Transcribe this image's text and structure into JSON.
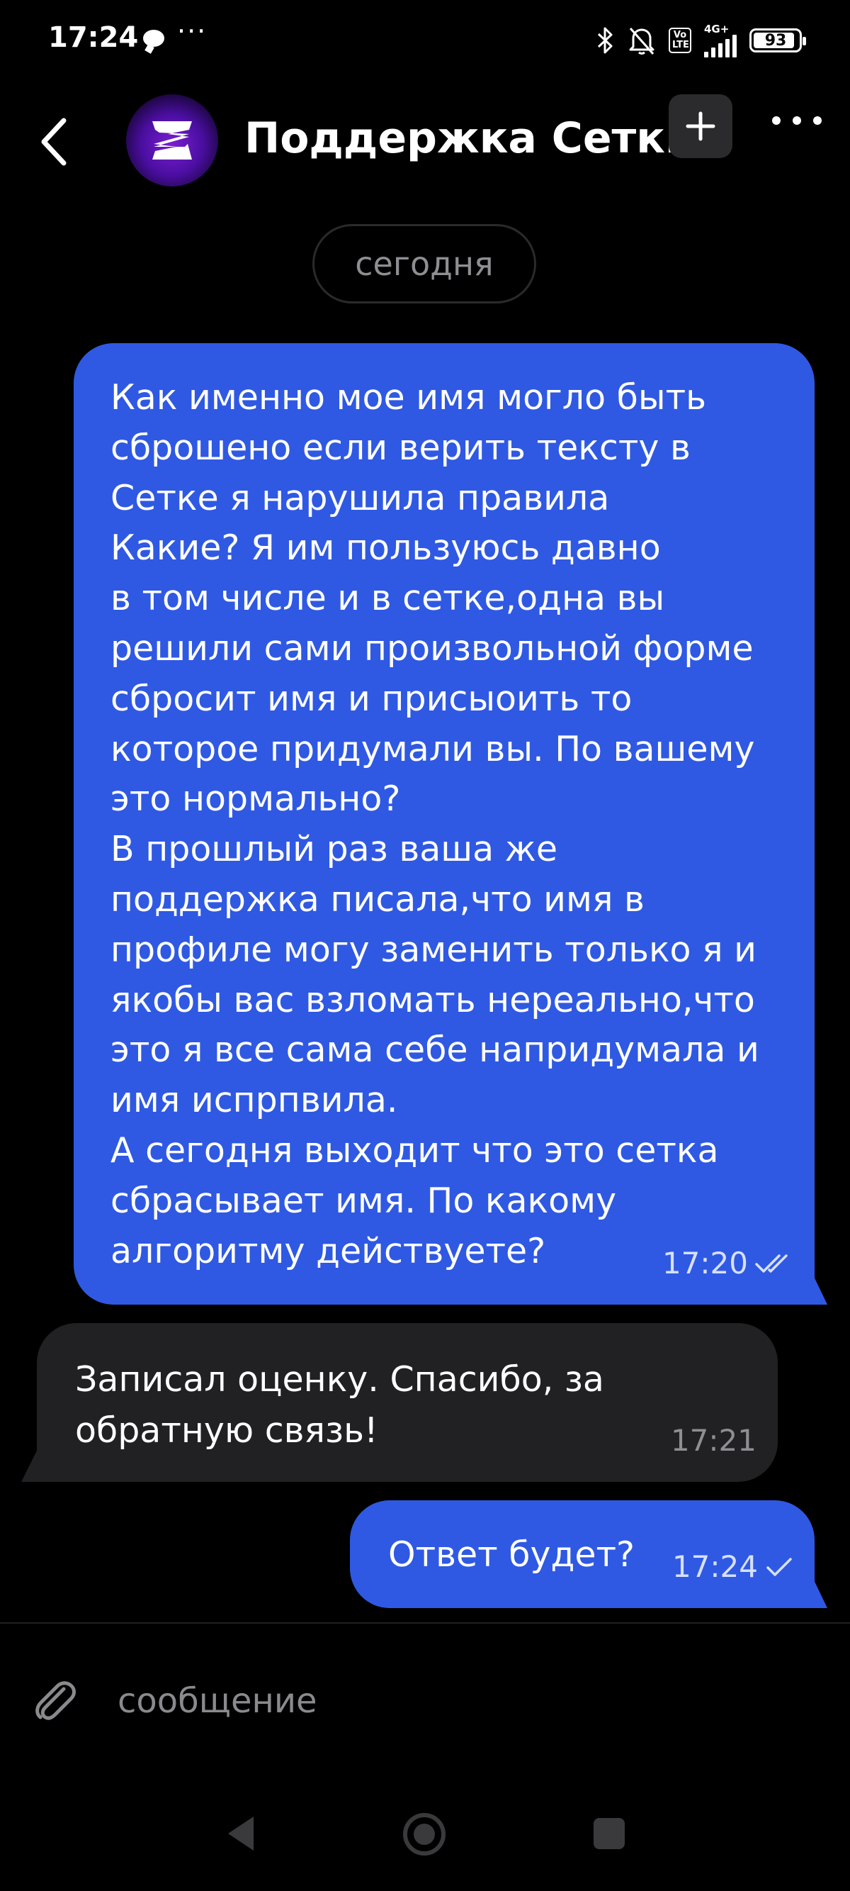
{
  "status_bar": {
    "time": "17:24",
    "more_indicator": "···",
    "network": "4G+",
    "volte": "Vo LTE",
    "battery_percent": 93,
    "battery_label": "93",
    "icons": [
      "chat-notification-icon",
      "bluetooth-icon",
      "bell-off-icon",
      "volte-icon",
      "signal-icon",
      "battery-icon"
    ]
  },
  "header": {
    "title": "Поддержка Сетки",
    "back_icon": "chevron-left-icon",
    "add_icon": "plus-icon",
    "more_icon": "more-horizontal-icon",
    "avatar_icon": "setka-logo-icon"
  },
  "date_divider": "сегодня",
  "messages": [
    {
      "direction": "outgoing",
      "text": "Как именно мое имя могло быть\nсброшено если верить тексту в\nСетке я нарушила правила\nКакие?  Я им пользуюсь давно\nв том числе и в сетке,одна вы\nрешили сами произвольной форме\nсбросит имя и присыоить то\nкоторое придумали вы. По вашему\nэто нормально?\nВ прошлый раз ваша же\nподдержка писала,что имя в\nпрофиле могу заменить только я и\nякобы вас взломать нереально,что\nэто я все сама себе напридумала и\nимя испрпвила.\nА сегодня выходит что это сетка\nсбрасывает имя. По какому\nалгоритму действуете?",
      "time": "17:20",
      "status_icon": "double-check-icon"
    },
    {
      "direction": "incoming",
      "text": "Записал оценку. Спасибо, за\nобратную связь!",
      "time": "17:21"
    },
    {
      "direction": "outgoing",
      "text": "Ответ будет?",
      "time": "17:24",
      "status_icon": "check-icon"
    }
  ],
  "composer": {
    "placeholder": "сообщение",
    "value": "",
    "attach_icon": "paperclip-icon"
  },
  "nav_bar": {
    "icons": [
      "nav-back-icon",
      "nav-home-icon",
      "nav-recents-icon"
    ]
  },
  "colors": {
    "background": "#000000",
    "outgoing_bubble": "#2f59e3",
    "incoming_bubble": "#212123",
    "muted_text": "#8e8e93"
  }
}
